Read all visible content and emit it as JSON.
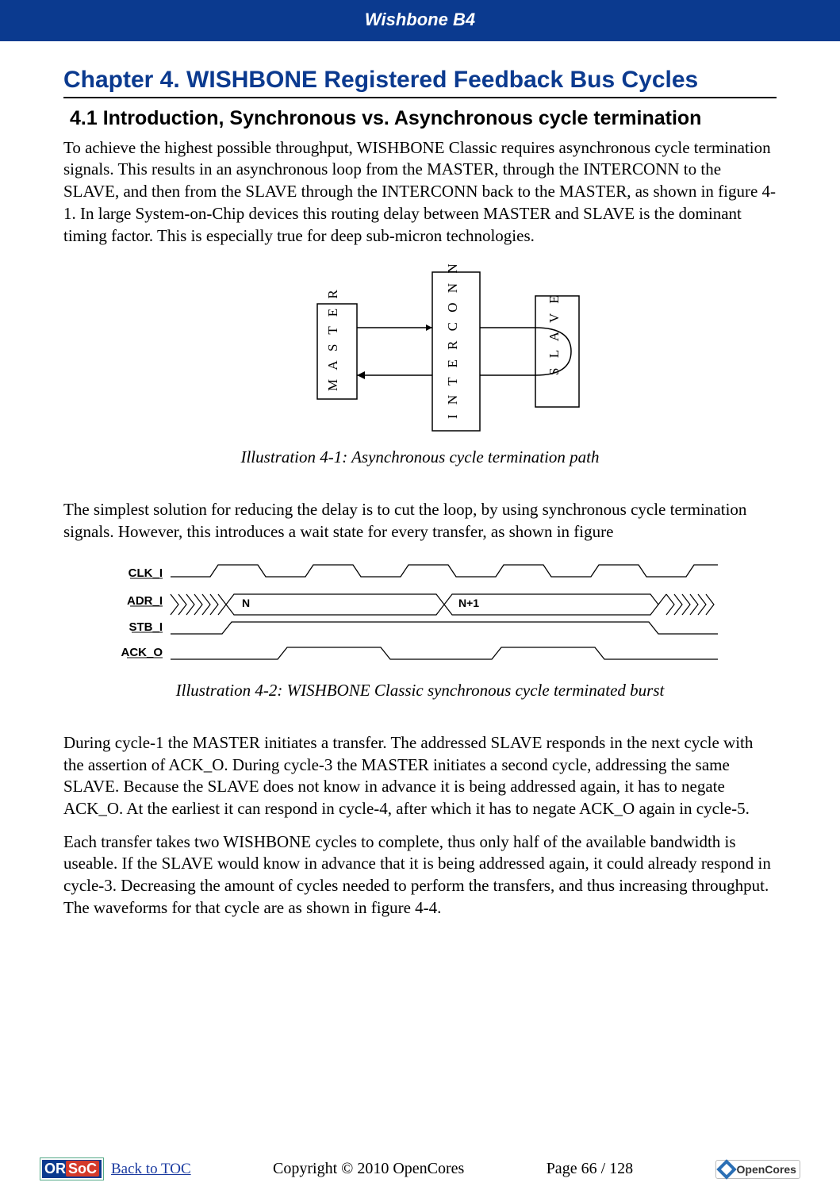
{
  "header": {
    "title": "Wishbone B4"
  },
  "chapter": {
    "title": "Chapter 4.  WISHBONE Registered Feedback Bus Cycles"
  },
  "section": {
    "number_and_title": "4.1    Introduction, Synchronous vs. Asynchronous cycle termination"
  },
  "paragraphs": {
    "p1": "To achieve the highest possible throughput, WISHBONE Classic requires asynchronous cycle termination signals. This results in an asynchronous loop from the MASTER, through the INTERCONN to the SLAVE, and then from the SLAVE through the INTERCONN back to the MASTER, as shown in figure 4-1. In large System-on-Chip devices this routing delay between MASTER and SLAVE is the dominant timing factor. This is especially true for deep sub-micron technologies.",
    "p2": "The simplest solution for reducing the delay is to cut the loop, by using synchronous cycle termination signals. However, this introduces a wait state for every transfer, as shown in figure",
    "p3": "During cycle-1 the MASTER initiates a transfer. The addressed SLAVE responds in the next cycle with the assertion of ACK_O. During cycle-3 the MASTER initiates a second cycle, addressing the same SLAVE. Because the SLAVE does not know in advance it is being addressed again, it has to negate ACK_O. At the earliest it can respond in cycle-4, after which it has to negate ACK_O again in cycle-5.",
    "p4": "Each transfer takes two WISHBONE cycles to complete, thus only half of the available bandwidth is useable. If the SLAVE would know in advance that it is being addressed again, it could already respond in cycle-3. Decreasing the amount of cycles needed to perform the transfers, and thus increasing throughput. The waveforms for that cycle are as shown in figure 4-4."
  },
  "figures": {
    "fig1": {
      "caption": "Illustration 4-1: Asynchronous cycle termination path",
      "blocks": {
        "master": "M A S T E R",
        "interconn": "I N T E R C O N N",
        "slave": "S L A V E"
      }
    },
    "fig2": {
      "caption": "Illustration 4-2: WISHBONE Classic synchronous cycle terminated burst",
      "signals": {
        "clk": "CLK_I",
        "adr": "ADR_I",
        "stb": "STB_I",
        "ack": "ACK_O"
      },
      "adr_values": {
        "n": "N",
        "n1": "N+1"
      }
    }
  },
  "footer": {
    "toc_link": "Back to TOC",
    "copyright": "Copyright © 2010 OpenCores",
    "page_label": "Page 66 / 128",
    "orsoc_text_a": "OR",
    "orsoc_text_b": "SoC",
    "opencores_text": "OpenCores"
  }
}
